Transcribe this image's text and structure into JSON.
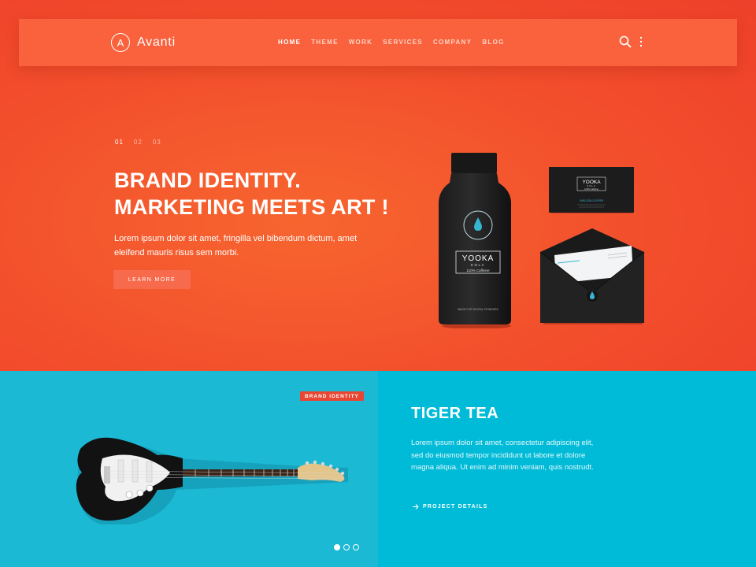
{
  "brand": {
    "name": "Avanti",
    "mark": "A"
  },
  "nav": {
    "items": [
      "HOME",
      "THEME",
      "WORK",
      "SERVICES",
      "COMPANY",
      "BLOG"
    ],
    "active": "HOME",
    "search_icon": "search-icon",
    "more_icon": "more-vertical-icon"
  },
  "hero": {
    "pager": [
      "01",
      "02",
      "03"
    ],
    "title_line1": "BRAND IDENTITY.",
    "title_line2": "MARKETING MEETS ART !",
    "text": "Lorem ipsum dolor sit amet, fringilla vel bibendum dictum, amet eleifend mauris risus sem morbi.",
    "button": "LEARN MORE"
  },
  "mockup": {
    "bottle_brand": "YOOKA",
    "bottle_sub": "KOLA",
    "bottle_caption": "110% Caffeine",
    "bottle_footer": "MADE FOR DIGITAL PIONEERS",
    "card_brand": "YOOKA",
    "card_sub": "KOLA",
    "card_caption": "110% Caffeine",
    "card_name": "SHELDON COOPER"
  },
  "portfolio": {
    "badge": "BRAND IDENTITY",
    "title": "TIGER TEA",
    "text": "Lorem ipsum dolor sit amet, consectetur adipiscing elit, sed do eiusmod tempor incididunt ut labore et dolore magna aliqua. Ut enim ad minim veniam, quis nostrudt.",
    "link": "PROJECT DETAILS"
  },
  "colors": {
    "hero_bg": "#f24e2c",
    "navbar_bg": "#f9623d",
    "teal": "#00bbd7",
    "badge": "#e84632"
  }
}
